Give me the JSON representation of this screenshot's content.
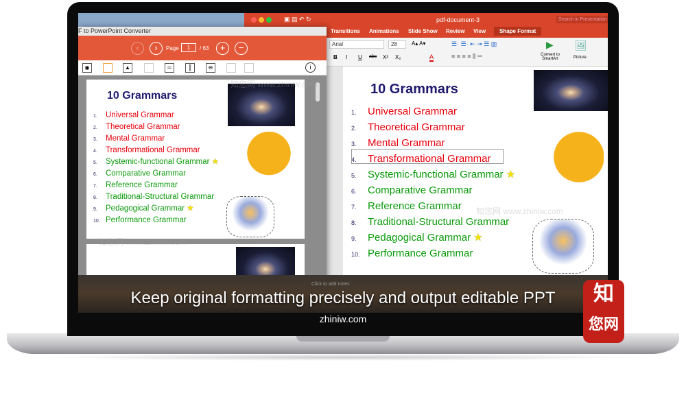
{
  "left_window": {
    "title": "F to PowerPoint Converter",
    "page_label": "Page",
    "page_value": "1",
    "page_total": "/ 63",
    "prev_icon": "chevron-left",
    "next_icon": "chevron-right",
    "zoom_in_icon": "plus",
    "zoom_out_icon": "minus",
    "info_icon": "i"
  },
  "right_window": {
    "title": "pdf-document-3",
    "search_placeholder": "Search in Presentation",
    "tabs": [
      "Transitions",
      "Animations",
      "Slide Show",
      "Review",
      "View",
      "Shape Format"
    ],
    "active_tab": "Shape Format",
    "font": "Arial",
    "font_size": "28",
    "format_buttons": [
      "B",
      "I",
      "U",
      "abc",
      "X²",
      "X₂"
    ],
    "convert_label": "Convert to SmartArt",
    "picture_label": "Picture",
    "notes_placeholder": "Click to add notes"
  },
  "slide": {
    "title": "10 Grammars",
    "items": [
      {
        "n": "1.",
        "t": "Universal Grammar",
        "c": "red"
      },
      {
        "n": "2.",
        "t": "Theoretical Grammar",
        "c": "red"
      },
      {
        "n": "3.",
        "t": "Mental Grammar",
        "c": "red"
      },
      {
        "n": "4.",
        "t": "Transformational Grammar",
        "c": "red"
      },
      {
        "n": "5.",
        "t": "Systemic-functional Grammar",
        "c": "green",
        "star": true
      },
      {
        "n": "6.",
        "t": "Comparative Grammar",
        "c": "green"
      },
      {
        "n": "7.",
        "t": "Reference Grammar",
        "c": "green"
      },
      {
        "n": "8.",
        "t": "Traditional-Structural Grammar",
        "c": "green"
      },
      {
        "n": "9.",
        "t": "Pedagogical Grammar",
        "c": "green",
        "star": true
      },
      {
        "n": "10.",
        "t": "Performance Grammar",
        "c": "green"
      }
    ]
  },
  "caption": "Keep original formatting precisely and output editable PPT",
  "site": "zhiniw.com",
  "watermark": "知您网 www.zhiniw.com",
  "stamp": "知您网",
  "colors": {
    "orange": "#e4583a",
    "ppt_red": "#d8452a",
    "red_text": "#e8000b",
    "green_text": "#0a9a0a",
    "title": "#1f1a6e"
  }
}
